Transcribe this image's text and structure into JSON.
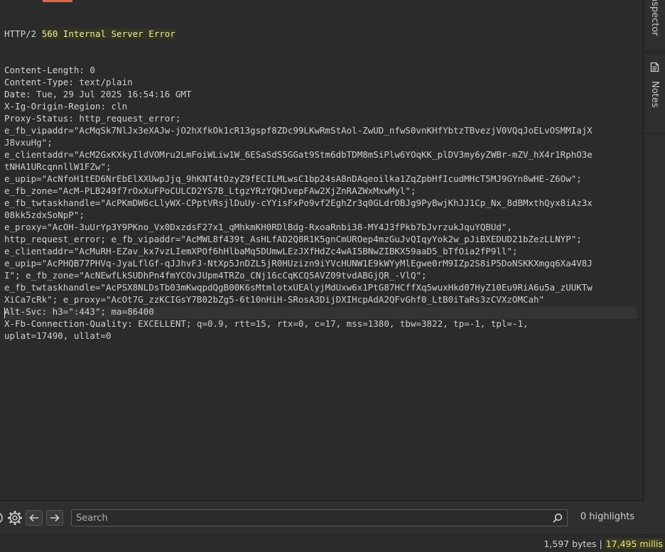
{
  "response": {
    "status_line_prefix": "HTTP/2 ",
    "status_line_value": "560 Internal Server Error",
    "lines": [
      {
        "name": "Content-Length:",
        "value": " 0"
      },
      {
        "name": "Content-Type:",
        "value": " text/plain"
      },
      {
        "name": "Date:",
        "value": " Tue, 29 Jul 2025 16:54:16 GMT"
      },
      {
        "name": "X-Ig-Origin-Region:",
        "value": " cln"
      },
      {
        "name": "Proxy-Status:",
        "value": " http_request_error;"
      },
      {
        "name": "",
        "value": "e_fb_vipaddr=\"AcMqSk7NlJx3eXAJw-jO2hXfkOk1cR13gspf8ZDc99LKwRmStAol-ZwUD_nfwS0vnKHfYbtzTBvezjV0VQqJoELvOSMMIajX"
      },
      {
        "name": "",
        "value": "J8vxuHg\";"
      },
      {
        "name": "",
        "value": "e_clientaddr=\"AcM2GxKXkyIldVOMru2LmFoiWLiw1W_6ESaSdS5GGat9Stm6dbTDM8mSiPlw6YOqKK_plDV3my6yZWBr-mZV_hX4r1RphO3e"
      },
      {
        "name": "",
        "value": "tNHA1URcqnnllW1FZw\";"
      },
      {
        "name": "",
        "value": "e_upip=\"AcNfoH1tED6NrEbElXXUwpJjq_9hKNT4tOzyZ9fECILMLwsC1bp24sA8nDAqeoilka1ZqZpbHfIcudMHcT5MJ9GYn8wHE-Z6Ow\";"
      },
      {
        "name": "",
        "value": "e_fb_zone=\"AcM-PLB249f7rOxXuFPoCULCD2YS7B_LtgzYRzYQHJvepFAw2XjZnRAZWxMxwMyl\";"
      },
      {
        "name": "",
        "value": "e_fb_twtaskhandle=\"AcPKmDW6cLlyWX-CPptVRsjlDuUy-cYYisFxPo9vf2EghZr3q0GLdrOBJg9PyBwjKhJJ1Cp_Nx_8dBMxthQyx8iAz3x"
      },
      {
        "name": "",
        "value": "08kk5zdxSoNpP\";"
      },
      {
        "name": "",
        "value": "e_proxy=\"AcOH-3uUrYp3Y9PKno_Vx0DxzdsF27x1_qMhkmKH0RDlBdg-RxoaRnbi38-MY4J3fPkb7bJvrzukJquYQBUd\","
      },
      {
        "name": "",
        "value": "http_request_error; e_fb_vipaddr=\"AcMWL8f439t_AsHLfAD2Q8R1K5gnCmUROep4mzGuJvQIqyYok2w_pJiBXEDUD21bZezLLNYP\";"
      },
      {
        "name": "",
        "value": "e_clientaddr=\"AcMuRH-EZav_kx7vzLIemXPOf6hHlbaMq5DUmwLEzJXfHdZc4wAI5BNwZIBKX59aaD5_bTfOia2fP9ll\";"
      },
      {
        "name": "",
        "value": "e_upip=\"AcPHQB77PHVq-JyaLflGf-qJJhvFJ-NtXp5JnDZL5jR0HUzizn9iYVcHUNW1E9kWYyMlEgwe0rM9IZp2S8iP5DoNSKKXmgq6Xa4V8J"
      },
      {
        "name": "",
        "value": "I\"; e_fb_zone=\"AcNEwfLkSUDhPn4fmYCOvJUpm4TRZo_CNj16cCqKCQ5AVZ09tvdABGjQR_-VlQ\";"
      },
      {
        "name": "",
        "value": "e_fb_twtaskhandle=\"AcPSX8NLDsTb03mKwqpdQgB00K6sMtmlotxUEAlyjMdUxw6x1PtG87HCffXq5wuxHkd07HyZ10Eu9RiA6u5a_zUUKTw"
      },
      {
        "name": "",
        "value": "XiCa7cRk\"; e_proxy=\"AcOt7G_zzKCIGsY7B02bZg5-6t10nHiH-SRosA3DijDXIHcpAdA2QFvGhf0_LtB0iTaRs3zCVXzOMCah\""
      },
      {
        "name": "Alt-Svc:",
        "value": " h3=\":443\"; ma=86400"
      },
      {
        "name": "X-Fb-Connection-Quality:",
        "value": " EXCELLENT; q=0.9, rtt=15, rtx=0, c=17, mss=1380, tbw=3822, tp=-1, tpl=-1,"
      },
      {
        "name": "",
        "value": "uplat=17490, ullat=0"
      }
    ]
  },
  "side_panel": {
    "inspector_label": "Inspector",
    "notes_label": "Notes"
  },
  "toolbar": {
    "search_placeholder": "Search",
    "highlights_label": "0 highlights"
  },
  "status_bar": {
    "bytes": "1,597 bytes",
    "separator": " | ",
    "millis": "17,495 millis"
  },
  "icons": {
    "settings": "gear-icon",
    "back": "arrow-left-icon",
    "forward": "arrow-right-icon",
    "search": "magnifier-icon",
    "notes": "notes-icon"
  },
  "colors": {
    "background": "#2b2b2b",
    "status_highlight": "#ececa0",
    "accent": "#e0674a"
  }
}
